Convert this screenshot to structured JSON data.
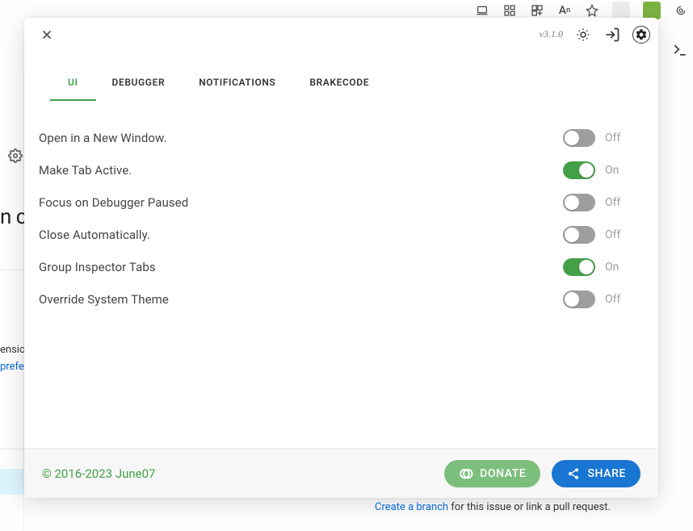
{
  "header": {
    "version": "v3.1.0"
  },
  "tabs": [
    {
      "key": "ui",
      "label": "UI",
      "active": true
    },
    {
      "key": "debugger",
      "label": "DEBUGGER",
      "active": false
    },
    {
      "key": "notifications",
      "label": "NOTIFICATIONS",
      "active": false
    },
    {
      "key": "brakecode",
      "label": "BRAKECODE",
      "active": false
    }
  ],
  "settings": [
    {
      "key": "open_new_window",
      "label": "Open in a New Window.",
      "on": false
    },
    {
      "key": "make_tab_active",
      "label": "Make Tab Active.",
      "on": true
    },
    {
      "key": "focus_paused",
      "label": "Focus on Debugger Paused",
      "on": false
    },
    {
      "key": "close_auto",
      "label": "Close Automatically.",
      "on": false
    },
    {
      "key": "group_inspector",
      "label": "Group Inspector Tabs",
      "on": true
    },
    {
      "key": "override_theme",
      "label": "Override System Theme",
      "on": false
    }
  ],
  "state_labels": {
    "on": "On",
    "off": "Off"
  },
  "footer": {
    "copyright": "© 2016-2023 June07",
    "donate": "DONATE",
    "share": "SHARE"
  },
  "background": {
    "truncated_heading": "n c",
    "ensid": "ensic",
    "prefe": "prefe",
    "create_branch_link": "Create a branch",
    "create_branch_tail": " for this issue or link a pull request."
  }
}
